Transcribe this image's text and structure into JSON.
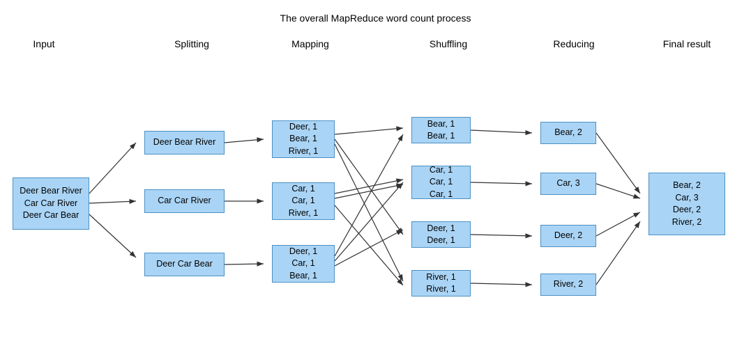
{
  "title": "The overall MapReduce word count process",
  "col_labels": {
    "input": "Input",
    "splitting": "Splitting",
    "mapping": "Mapping",
    "shuffling": "Shuffling",
    "reducing": "Reducing",
    "final": "Final result"
  },
  "boxes": {
    "input": "Deer Bear River\nCar Car River\nDeer Car Bear",
    "split1": "Deer Bear River",
    "split2": "Car Car River",
    "split3": "Deer Car Bear",
    "map1": "Deer, 1\nBear, 1\nRiver, 1",
    "map2": "Car, 1\nCar, 1\nRiver, 1",
    "map3": "Deer, 1\nCar, 1\nBear, 1",
    "shuf1": "Bear, 1\nBear, 1",
    "shuf2": "Car, 1\nCar, 1\nCar, 1",
    "shuf3": "Deer, 1\nDeer, 1",
    "shuf4": "River, 1\nRiver, 1",
    "red1": "Bear, 2",
    "red2": "Car, 3",
    "red3": "Deer, 2",
    "red4": "River, 2",
    "final": "Bear, 2\nCar, 3\nDeer, 2\nRiver, 2"
  }
}
